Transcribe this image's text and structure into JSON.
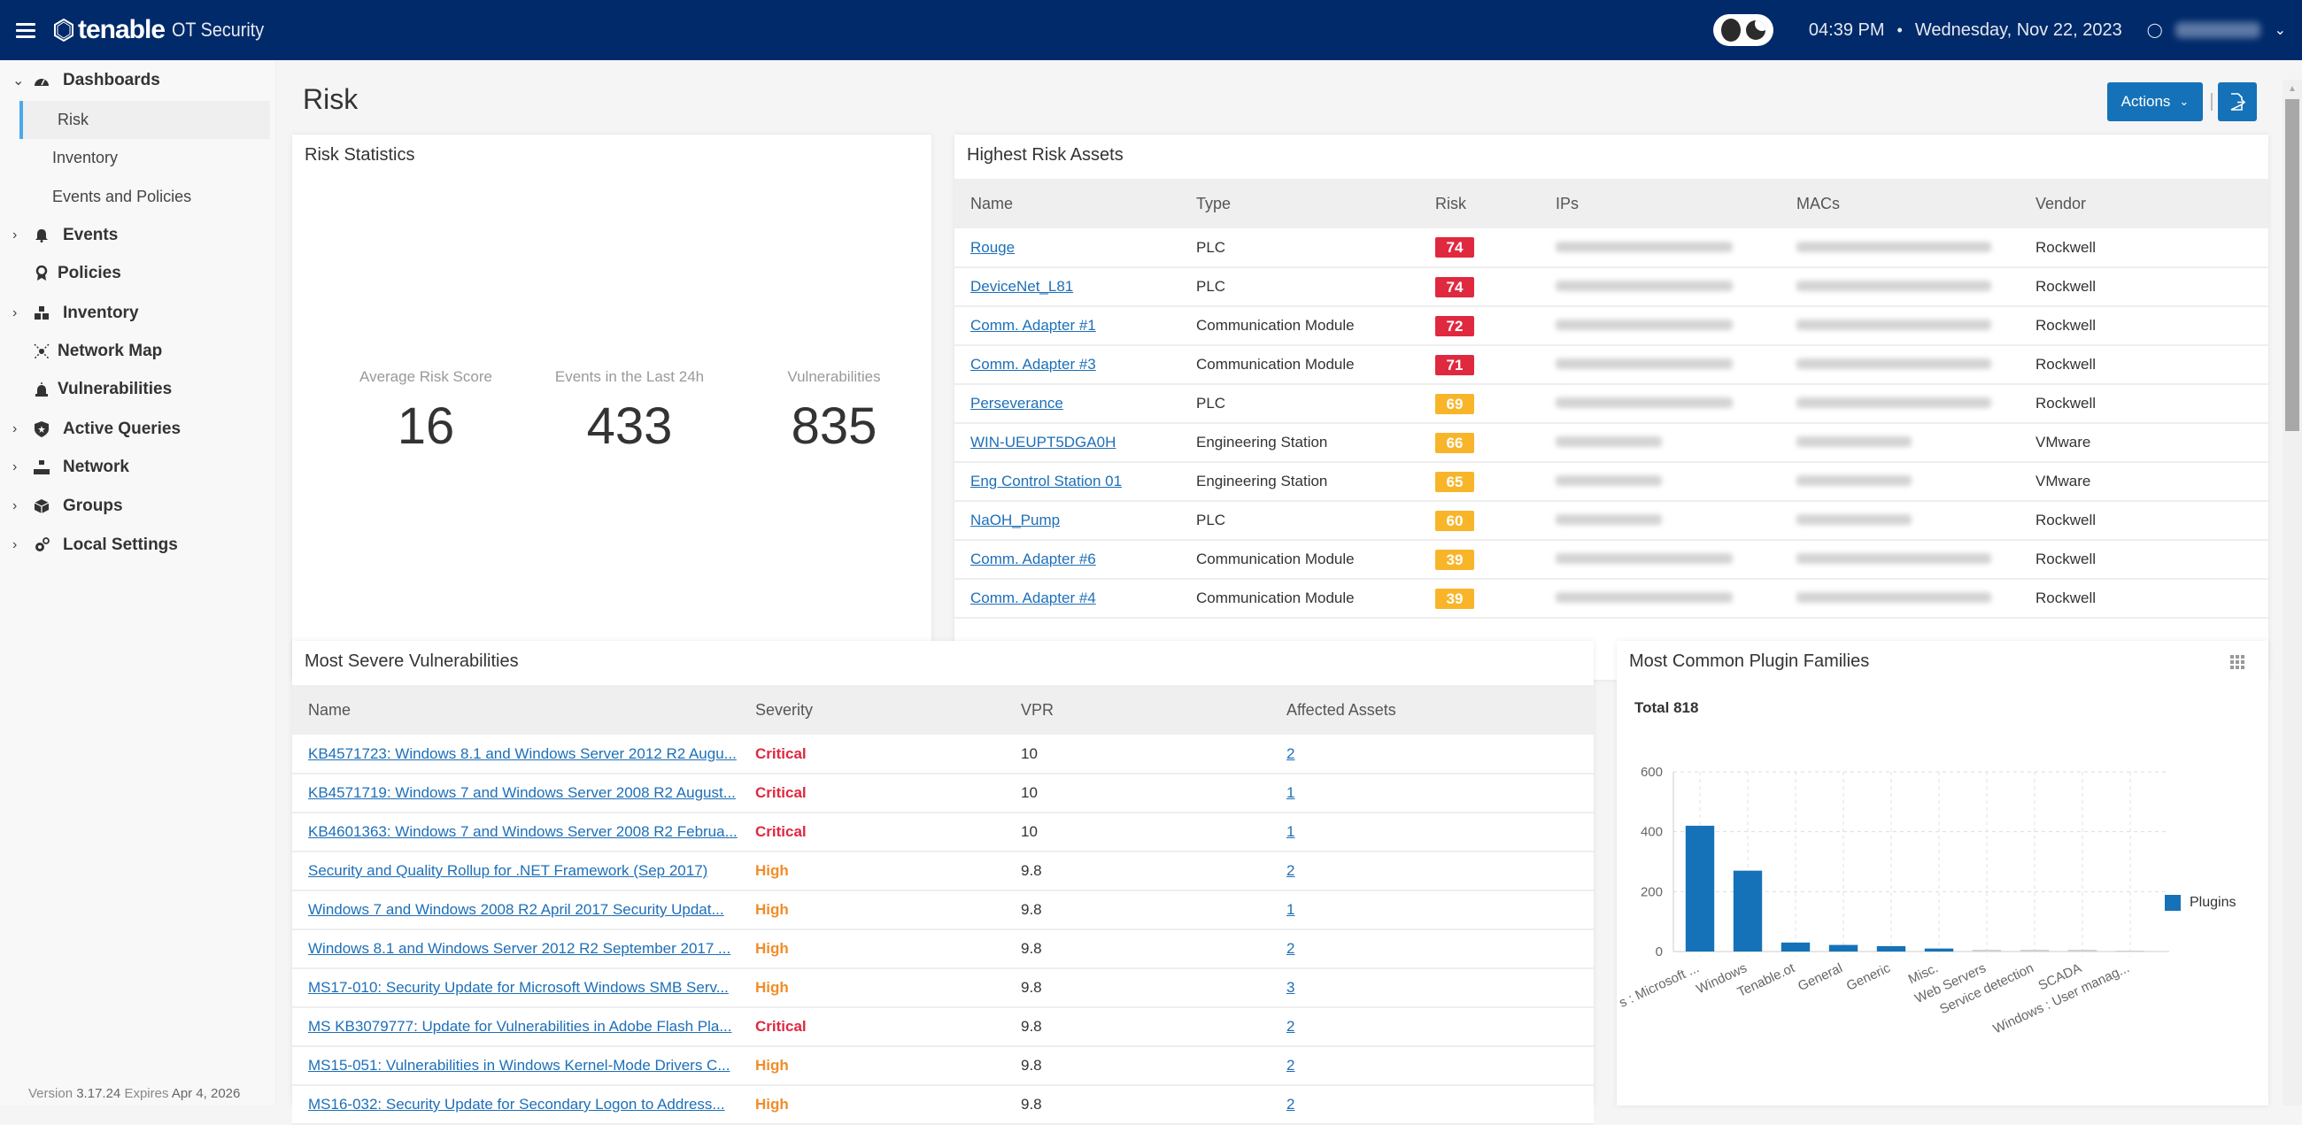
{
  "topbar": {
    "brand": "tenable",
    "product": "OT Security",
    "time": "04:39 PM",
    "separator": "•",
    "date": "Wednesday, Nov 22, 2023",
    "user_icon": "user-icon",
    "theme_toggle_icon": "dark-mode-toggle-icon"
  },
  "sidebar": {
    "items": [
      {
        "label": "Dashboards",
        "icon": "dashboard-gauge-icon",
        "expanded": true,
        "children": [
          {
            "label": "Risk",
            "active": true
          },
          {
            "label": "Inventory"
          },
          {
            "label": "Events and Policies"
          }
        ]
      },
      {
        "label": "Events",
        "icon": "bell-icon",
        "expandable": true
      },
      {
        "label": "Policies",
        "icon": "ribbon-badge-icon"
      },
      {
        "label": "Inventory",
        "icon": "boxes-icon",
        "expandable": true
      },
      {
        "label": "Network Map",
        "icon": "network-map-icon"
      },
      {
        "label": "Vulnerabilities",
        "icon": "siren-icon"
      },
      {
        "label": "Active Queries",
        "icon": "shield-icon",
        "expandable": true
      },
      {
        "label": "Network",
        "icon": "network-topology-icon",
        "expandable": true
      },
      {
        "label": "Groups",
        "icon": "cube-icon",
        "expandable": true
      },
      {
        "label": "Local Settings",
        "icon": "gears-icon",
        "expandable": true
      }
    ],
    "version_label": "Version",
    "version": "3.17.24",
    "expires_label": "Expires",
    "expires": "Apr 4, 2026"
  },
  "page": {
    "title": "Risk",
    "actions_label": "Actions",
    "export_icon": "export-file-icon"
  },
  "risk_statistics": {
    "title": "Risk Statistics",
    "stats": [
      {
        "label": "Average Risk Score",
        "value": "16"
      },
      {
        "label": "Events in the Last 24h",
        "value": "433"
      },
      {
        "label": "Vulnerabilities",
        "value": "835"
      }
    ]
  },
  "highest_risk_assets": {
    "title": "Highest Risk Assets",
    "columns": [
      "Name",
      "Type",
      "Risk",
      "IPs",
      "MACs",
      "Vendor"
    ],
    "rows": [
      {
        "name": "Rouge",
        "type": "PLC",
        "risk": "74",
        "level": "high",
        "ips_redacted": true,
        "vendor": "Rockwell"
      },
      {
        "name": "DeviceNet_L81",
        "type": "PLC",
        "risk": "74",
        "level": "high",
        "ips_redacted": true,
        "vendor": "Rockwell"
      },
      {
        "name": "Comm. Adapter #1",
        "type": "Communication Module",
        "risk": "72",
        "level": "high",
        "ips_redacted": true,
        "vendor": "Rockwell"
      },
      {
        "name": "Comm. Adapter #3",
        "type": "Communication Module",
        "risk": "71",
        "level": "high",
        "ips_redacted": true,
        "vendor": "Rockwell"
      },
      {
        "name": "Perseverance",
        "type": "PLC",
        "risk": "69",
        "level": "medium",
        "ips_redacted": true,
        "vendor": "Rockwell"
      },
      {
        "name": "WIN-UEUPT5DGA0H",
        "type": "Engineering Station",
        "risk": "66",
        "level": "medium",
        "ips_redacted": true,
        "vendor": "VMware"
      },
      {
        "name": "Eng Control Station 01",
        "type": "Engineering Station",
        "risk": "65",
        "level": "medium",
        "ips_redacted": true,
        "vendor": "VMware"
      },
      {
        "name": "NaOH_Pump",
        "type": "PLC",
        "risk": "60",
        "level": "medium",
        "ips_redacted": true,
        "vendor": "Rockwell"
      },
      {
        "name": "Comm. Adapter #6",
        "type": "Communication Module",
        "risk": "39",
        "level": "medium",
        "ips_redacted": true,
        "vendor": "Rockwell"
      },
      {
        "name": "Comm. Adapter #4",
        "type": "Communication Module",
        "risk": "39",
        "level": "medium",
        "ips_redacted": true,
        "vendor": "Rockwell"
      }
    ]
  },
  "most_severe_vulnerabilities": {
    "title": "Most Severe Vulnerabilities",
    "columns": [
      "Name",
      "Severity",
      "VPR",
      "Affected Assets"
    ],
    "rows": [
      {
        "name": "KB4571723: Windows 8.1 and Windows Server 2012 R2 Augu...",
        "severity": "Critical",
        "vpr": "10",
        "affected": "2"
      },
      {
        "name": "KB4571719: Windows 7 and Windows Server 2008 R2 August...",
        "severity": "Critical",
        "vpr": "10",
        "affected": "1"
      },
      {
        "name": "KB4601363: Windows 7 and Windows Server 2008 R2 Februa...",
        "severity": "Critical",
        "vpr": "10",
        "affected": "1"
      },
      {
        "name": "Security and Quality Rollup for .NET Framework (Sep 2017)",
        "severity": "High",
        "vpr": "9.8",
        "affected": "2"
      },
      {
        "name": "Windows 7 and Windows 2008 R2 April 2017 Security Updat...",
        "severity": "High",
        "vpr": "9.8",
        "affected": "1"
      },
      {
        "name": "Windows 8.1 and Windows Server 2012 R2 September 2017 ...",
        "severity": "High",
        "vpr": "9.8",
        "affected": "2"
      },
      {
        "name": "MS17-010: Security Update for Microsoft Windows SMB Serv...",
        "severity": "High",
        "vpr": "9.8",
        "affected": "3"
      },
      {
        "name": "MS KB3079777: Update for Vulnerabilities in Adobe Flash Pla...",
        "severity": "Critical",
        "vpr": "9.8",
        "affected": "2"
      },
      {
        "name": "MS15-051: Vulnerabilities in Windows Kernel-Mode Drivers C...",
        "severity": "High",
        "vpr": "9.8",
        "affected": "2"
      },
      {
        "name": "MS16-032: Security Update for Secondary Logon to Address...",
        "severity": "High",
        "vpr": "9.8",
        "affected": "2"
      }
    ]
  },
  "plugin_families": {
    "title": "Most Common Plugin Families",
    "total_label": "Total 818",
    "menu_icon": "grid-menu-icon"
  },
  "colors": {
    "brand_navy": "#002a6a",
    "primary_blue": "#1672b8",
    "link_blue": "#1d6fb8",
    "risk_high": "#e0283f",
    "risk_medium": "#f8b52a",
    "severity_critical": "#e0283f",
    "severity_high": "#f28c28",
    "bar_muted": "#d0d0d0"
  },
  "chart_data": {
    "type": "bar",
    "title": "Most Common Plugin Families",
    "subtitle": "Total 818",
    "categories": [
      "s : Microsoft ...",
      "Windows",
      "Tenable.ot",
      "General",
      "Generic",
      "Misc.",
      "Web Servers",
      "Service detection",
      "SCADA",
      "Windows : User manag..."
    ],
    "series": [
      {
        "name": "Plugins",
        "values": [
          420,
          270,
          30,
          22,
          18,
          10,
          6,
          6,
          6,
          3
        ]
      }
    ],
    "highlighted": [
      true,
      true,
      true,
      true,
      true,
      true,
      false,
      false,
      false,
      false
    ],
    "xlabel": "",
    "ylabel": "",
    "ylim": [
      0,
      600
    ],
    "yticks": [
      0,
      200,
      400,
      600
    ],
    "grid": true,
    "legend": "right"
  }
}
